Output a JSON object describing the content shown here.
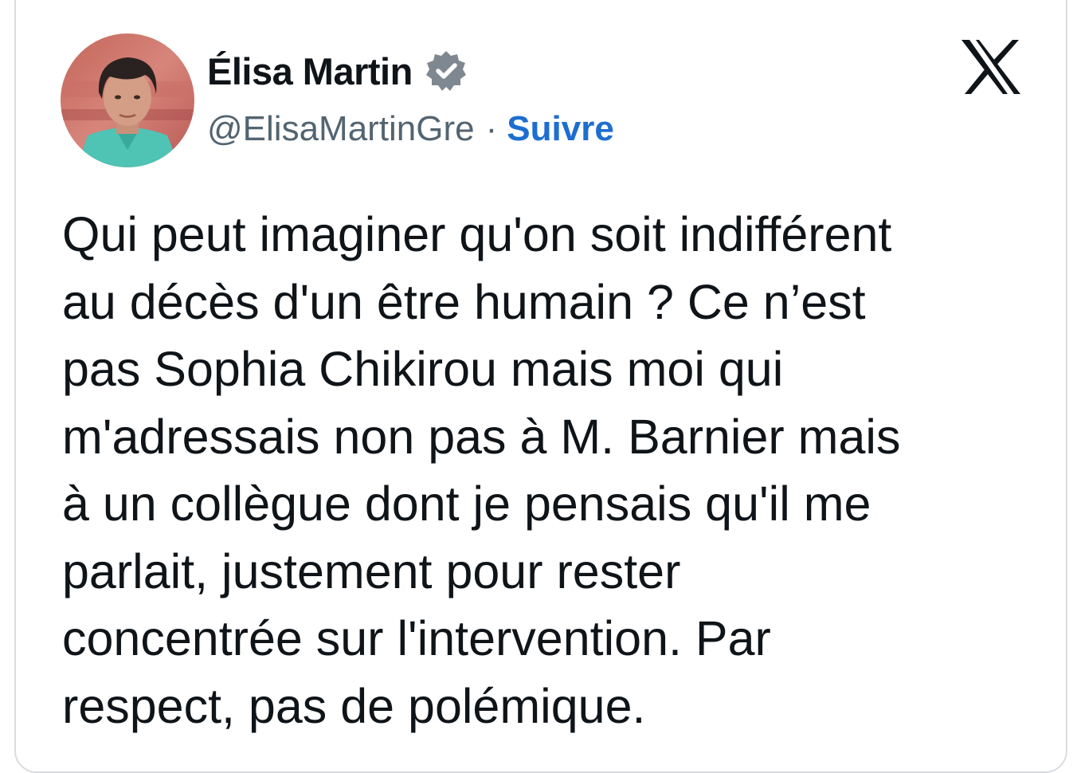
{
  "author": {
    "display_name": "Élisa Martin",
    "handle": "@ElisaMartinGre",
    "separator": "·",
    "follow_label": "Suivre",
    "verified": true,
    "avatar_icon": "profile-photo"
  },
  "brand": {
    "logo_icon": "x-logo-icon"
  },
  "tweet": {
    "text": "Qui peut imaginer qu'on soit indifférent\nau décès d'un être humain ? Ce n’est\npas Sophia Chikirou mais moi qui\nm'adressais non pas à M. Barnier mais\nà un collègue dont je pensais qu'il me\nparlait, justement pour rester\nconcentrée sur l'intervention. Par\nrespect, pas de polémique."
  },
  "colors": {
    "text": "#0f1419",
    "muted": "#536471",
    "link": "#1d6ecf",
    "border": "#d9dde1"
  }
}
